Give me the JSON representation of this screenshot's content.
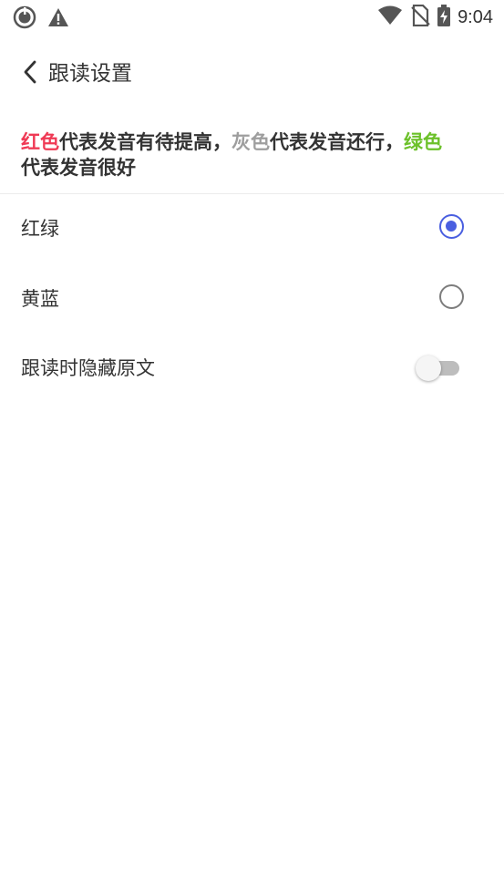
{
  "status_bar": {
    "time": "9:04",
    "left_icons": [
      "sync-icon",
      "warning-icon"
    ],
    "right_icons": [
      "wifi-icon",
      "no-sim-icon",
      "battery-charging-icon"
    ]
  },
  "header": {
    "back_icon": "chevron-left-icon",
    "title": "跟读设置"
  },
  "legend": {
    "red_word": "红色",
    "red_desc": "代表发音有待提高，",
    "gray_word": "灰色",
    "gray_desc": "代表发音还行，",
    "green_word": "绿色",
    "green_desc": "代表发音很好",
    "colors": {
      "red": "#ef3a55",
      "gray": "#9e9e9e",
      "green": "#6cc12a"
    }
  },
  "options": [
    {
      "label": "红绿",
      "type": "radio",
      "checked": true
    },
    {
      "label": "黄蓝",
      "type": "radio",
      "checked": false
    },
    {
      "label": "跟读时隐藏原文",
      "type": "switch",
      "on": false
    }
  ],
  "accent_color": "#4a5fe0"
}
